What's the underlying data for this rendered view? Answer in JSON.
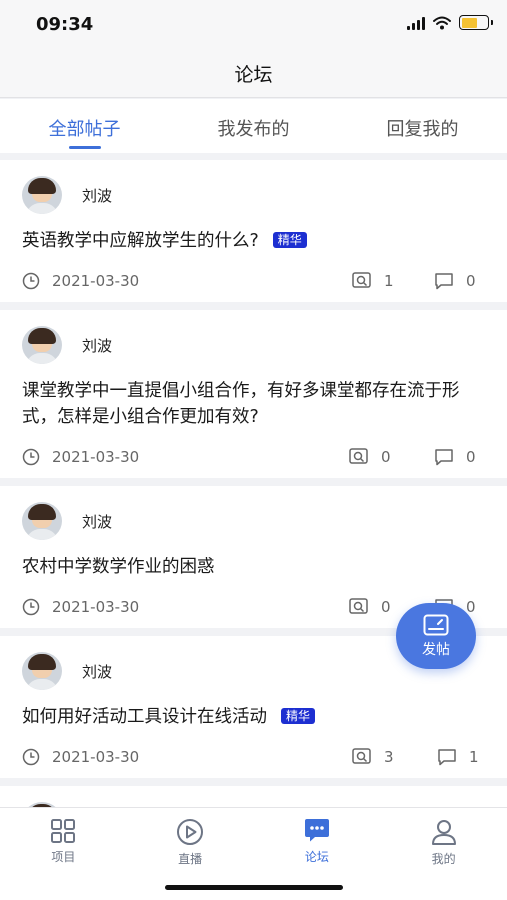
{
  "status_bar": {
    "time": "09:34"
  },
  "nav": {
    "title": "论坛"
  },
  "tabs": [
    {
      "label": "全部帖子",
      "active": true
    },
    {
      "label": "我发布的",
      "active": false
    },
    {
      "label": "回复我的",
      "active": false
    }
  ],
  "posts": [
    {
      "author": "刘波",
      "title": "英语教学中应解放学生的什么?",
      "badge": "精华",
      "date": "2021-03-30",
      "views": "1",
      "replies": "0"
    },
    {
      "author": "刘波",
      "title": "课堂教学中一直提倡小组合作，有好多课堂都存在流于形式，怎样是小组合作更加有效?",
      "badge": "",
      "date": "2021-03-30",
      "views": "0",
      "replies": "0"
    },
    {
      "author": "刘波",
      "title": "农村中学数学作业的困惑",
      "badge": "",
      "date": "2021-03-30",
      "views": "0",
      "replies": "0"
    },
    {
      "author": "刘波",
      "title": "如何用好活动工具设计在线活动",
      "badge": "精华",
      "date": "2021-03-30",
      "views": "3",
      "replies": "1"
    }
  ],
  "fab": {
    "label": "发帖"
  },
  "tabbar": [
    {
      "label": "项目",
      "icon": "grid-icon",
      "active": false
    },
    {
      "label": "直播",
      "icon": "play-icon",
      "active": false
    },
    {
      "label": "论坛",
      "icon": "forum-icon",
      "active": true
    },
    {
      "label": "我的",
      "icon": "user-icon",
      "active": false
    }
  ],
  "colors": {
    "accent": "#3d6fd9",
    "badge": "#1d2fd1",
    "fab": "#4a77e0"
  }
}
